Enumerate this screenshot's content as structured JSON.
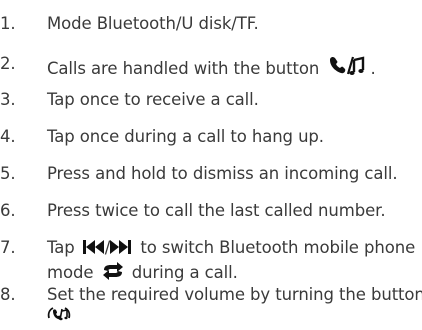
{
  "items": [
    {
      "num": "1.",
      "text": "Mode Bluetooth/U disk/TF."
    },
    {
      "num": "2.",
      "text": "Calls are handled with the button",
      "suffix": "."
    },
    {
      "num": "3.",
      "text": "Tap once to receive a call."
    },
    {
      "num": "4.",
      "text": "Tap once during a call to hang up."
    },
    {
      "num": "5.",
      "text": "Press and hold to dismiss an incoming call."
    },
    {
      "num": "6.",
      "text": "Press twice to call the last called number."
    },
    {
      "num": "7.",
      "text_a": "Tap",
      "text_b": "to switch Bluetooth mobile phone",
      "text_c": "mode",
      "text_d": "during a call."
    },
    {
      "num": "8.",
      "text_a": "Set the required volume by turning the button"
    }
  ],
  "icons": {
    "call_music": "call-music-icon",
    "prev": "previous-track-icon",
    "next": "next-track-icon",
    "switch": "swap-arrows-icon"
  }
}
